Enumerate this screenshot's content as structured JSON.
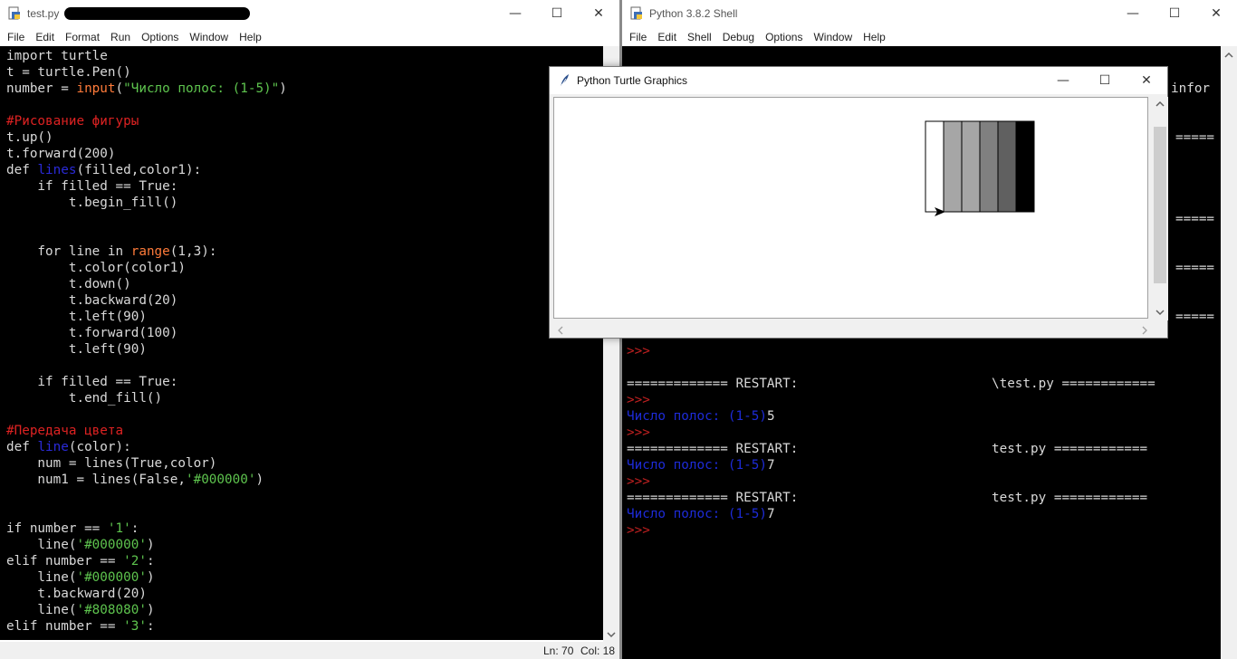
{
  "editor_window": {
    "title": "test.py",
    "menu": [
      "File",
      "Edit",
      "Format",
      "Run",
      "Options",
      "Window",
      "Help"
    ],
    "code_lines": [
      [
        {
          "t": "import turtle",
          "c": "plain"
        }
      ],
      [
        {
          "t": "t = turtle.Pen()",
          "c": "plain"
        }
      ],
      [
        {
          "t": "number = ",
          "c": "plain"
        },
        {
          "t": "input",
          "c": "bi"
        },
        {
          "t": "(",
          "c": "plain"
        },
        {
          "t": "\"Число полос: (1-5)\"",
          "c": "str"
        },
        {
          "t": ")",
          "c": "plain"
        }
      ],
      [
        {
          "t": "",
          "c": "plain"
        }
      ],
      [
        {
          "t": "#Рисование фигуры",
          "c": "cmt"
        }
      ],
      [
        {
          "t": "t.up()",
          "c": "plain"
        }
      ],
      [
        {
          "t": "t.forward(200)",
          "c": "plain"
        }
      ],
      [
        {
          "t": "def ",
          "c": "plain"
        },
        {
          "t": "lines",
          "c": "fn"
        },
        {
          "t": "(filled,color1):",
          "c": "plain"
        }
      ],
      [
        {
          "t": "    if filled == True:",
          "c": "plain"
        }
      ],
      [
        {
          "t": "        t.begin_fill()",
          "c": "plain"
        }
      ],
      [
        {
          "t": "",
          "c": "plain"
        }
      ],
      [
        {
          "t": "",
          "c": "plain"
        }
      ],
      [
        {
          "t": "    for line in ",
          "c": "plain"
        },
        {
          "t": "range",
          "c": "bi"
        },
        {
          "t": "(1,3):",
          "c": "plain"
        }
      ],
      [
        {
          "t": "        t.color(color1)",
          "c": "plain"
        }
      ],
      [
        {
          "t": "        t.down()",
          "c": "plain"
        }
      ],
      [
        {
          "t": "        t.backward(20)",
          "c": "plain"
        }
      ],
      [
        {
          "t": "        t.left(90)",
          "c": "plain"
        }
      ],
      [
        {
          "t": "        t.forward(100)",
          "c": "plain"
        }
      ],
      [
        {
          "t": "        t.left(90)",
          "c": "plain"
        }
      ],
      [
        {
          "t": "",
          "c": "plain"
        }
      ],
      [
        {
          "t": "    if filled == True:",
          "c": "plain"
        }
      ],
      [
        {
          "t": "        t.end_fill()",
          "c": "plain"
        }
      ],
      [
        {
          "t": "",
          "c": "plain"
        }
      ],
      [
        {
          "t": "#Передача цвета",
          "c": "cmt"
        }
      ],
      [
        {
          "t": "def ",
          "c": "plain"
        },
        {
          "t": "line",
          "c": "fn"
        },
        {
          "t": "(color):",
          "c": "plain"
        }
      ],
      [
        {
          "t": "    num = lines(True,color)",
          "c": "plain"
        }
      ],
      [
        {
          "t": "    num1 = lines(False,",
          "c": "plain"
        },
        {
          "t": "'#000000'",
          "c": "str"
        },
        {
          "t": ")",
          "c": "plain"
        }
      ],
      [
        {
          "t": "",
          "c": "plain"
        }
      ],
      [
        {
          "t": "",
          "c": "plain"
        }
      ],
      [
        {
          "t": "if number == ",
          "c": "plain"
        },
        {
          "t": "'1'",
          "c": "str"
        },
        {
          "t": ":",
          "c": "plain"
        }
      ],
      [
        {
          "t": "    line(",
          "c": "plain"
        },
        {
          "t": "'#000000'",
          "c": "str"
        },
        {
          "t": ")",
          "c": "plain"
        }
      ],
      [
        {
          "t": "elif number == ",
          "c": "plain"
        },
        {
          "t": "'2'",
          "c": "str"
        },
        {
          "t": ":",
          "c": "plain"
        }
      ],
      [
        {
          "t": "    line(",
          "c": "plain"
        },
        {
          "t": "'#000000'",
          "c": "str"
        },
        {
          "t": ")",
          "c": "plain"
        }
      ],
      [
        {
          "t": "    t.backward(20)",
          "c": "plain"
        }
      ],
      [
        {
          "t": "    line(",
          "c": "plain"
        },
        {
          "t": "'#808080'",
          "c": "str"
        },
        {
          "t": ")",
          "c": "plain"
        }
      ],
      [
        {
          "t": "elif number == ",
          "c": "plain"
        },
        {
          "t": "'3'",
          "c": "str"
        },
        {
          "t": ":",
          "c": "plain"
        }
      ]
    ],
    "status": {
      "ln": "Ln: 70",
      "col": "Col: 18"
    }
  },
  "shell_window": {
    "title": "Python 3.8.2 Shell",
    "menu": [
      "File",
      "Edit",
      "Shell",
      "Debug",
      "Options",
      "Window",
      "Help"
    ],
    "visible_fragments": {
      "infor": "infor",
      "sep": "====="
    },
    "lines": [
      [
        {
          "t": ">>>",
          "c": "prompt"
        }
      ],
      [
        {
          "t": "",
          "c": "plain"
        }
      ],
      [
        {
          "t": "============= RESTART: ",
          "c": "plain"
        },
        {
          "t": "REDACT",
          "c": "redact"
        },
        {
          "t": "\\test.py ============",
          "c": "plain"
        }
      ],
      [
        {
          "t": ">>>",
          "c": "prompt"
        }
      ],
      [
        {
          "t": "Число полос: (1-5)",
          "c": "shellout"
        },
        {
          "t": "5",
          "c": "plain"
        }
      ],
      [
        {
          "t": ">>>",
          "c": "prompt"
        }
      ],
      [
        {
          "t": "============= RESTART: ",
          "c": "plain"
        },
        {
          "t": "REDACT",
          "c": "redact"
        },
        {
          "t": "test.py ============",
          "c": "plain"
        }
      ],
      [
        {
          "t": "Число полос: (1-5)",
          "c": "shellout"
        },
        {
          "t": "7",
          "c": "plain"
        }
      ],
      [
        {
          "t": ">>>",
          "c": "prompt"
        }
      ],
      [
        {
          "t": "============= RESTART: ",
          "c": "plain"
        },
        {
          "t": "REDACT",
          "c": "redact"
        },
        {
          "t": "test.py ============",
          "c": "plain"
        }
      ],
      [
        {
          "t": "Число полос: (1-5)",
          "c": "shellout"
        },
        {
          "t": "7",
          "c": "plain"
        }
      ],
      [
        {
          "t": ">>>",
          "c": "prompt"
        }
      ]
    ]
  },
  "turtle_window": {
    "title": "Python Turtle Graphics",
    "stripes": [
      "#ffffff",
      "#a6a6a6",
      "#a6a6a6",
      "#808080",
      "#606060",
      "#000000"
    ]
  },
  "colors": {
    "editor_bg": "#000000",
    "comment": "#dd2222",
    "string": "#5ec44e",
    "builtin": "#ff7b3a",
    "defname": "#2a2ad8",
    "shell_output": "#1d2bd8"
  }
}
